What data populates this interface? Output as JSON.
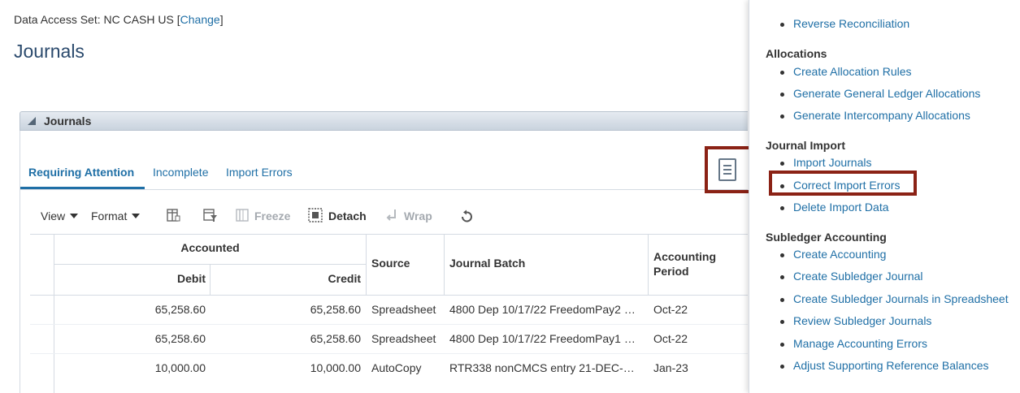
{
  "header": {
    "data_access_label": "Data Access Set:",
    "data_access_value": "NC CASH US",
    "change_link": "Change",
    "page_title": "Journals"
  },
  "panel": {
    "title": "Journals",
    "tabs": [
      {
        "label": "Requiring Attention",
        "active": true
      },
      {
        "label": "Incomplete",
        "active": false
      },
      {
        "label": "Import Errors",
        "active": false
      }
    ]
  },
  "toolbar": {
    "view": "View",
    "format": "Format",
    "freeze": "Freeze",
    "detach": "Detach",
    "wrap": "Wrap"
  },
  "table": {
    "group_header": "Accounted",
    "columns": {
      "debit": "Debit",
      "credit": "Credit",
      "source": "Source",
      "journal_batch": "Journal Batch",
      "accounting_period_line1": "Accounting",
      "accounting_period_line2": "Period"
    },
    "rows": [
      {
        "debit": "65,258.60",
        "credit": "65,258.60",
        "source": "Spreadsheet",
        "batch": "4800 Dep 10/17/22 FreedomPay2 …",
        "period": "Oct-22"
      },
      {
        "debit": "65,258.60",
        "credit": "65,258.60",
        "source": "Spreadsheet",
        "batch": "4800 Dep 10/17/22 FreedomPay1 …",
        "period": "Oct-22"
      },
      {
        "debit": "10,000.00",
        "credit": "10,000.00",
        "source": "AutoCopy",
        "batch": "RTR338 nonCMCS entry 21-DEC-…",
        "period": "Jan-23"
      }
    ]
  },
  "side_panel": {
    "top_item": "Reverse Reconciliation",
    "sections": [
      {
        "title": "Allocations",
        "items": [
          "Create Allocation Rules",
          "Generate General Ledger Allocations",
          "Generate Intercompany Allocations"
        ]
      },
      {
        "title": "Journal Import",
        "items": [
          "Import Journals",
          "Correct Import Errors",
          "Delete Import Data"
        ]
      },
      {
        "title": "Subledger Accounting",
        "items": [
          "Create Accounting",
          "Create Subledger Journal",
          "Create Subledger Journals in Spreadsheet",
          "Review Subledger Journals",
          "Manage Accounting Errors",
          "Adjust Supporting Reference Balances"
        ]
      }
    ]
  },
  "colors": {
    "link": "#1f6fa6",
    "highlight": "#8b2215",
    "title": "#2b4a6d"
  }
}
